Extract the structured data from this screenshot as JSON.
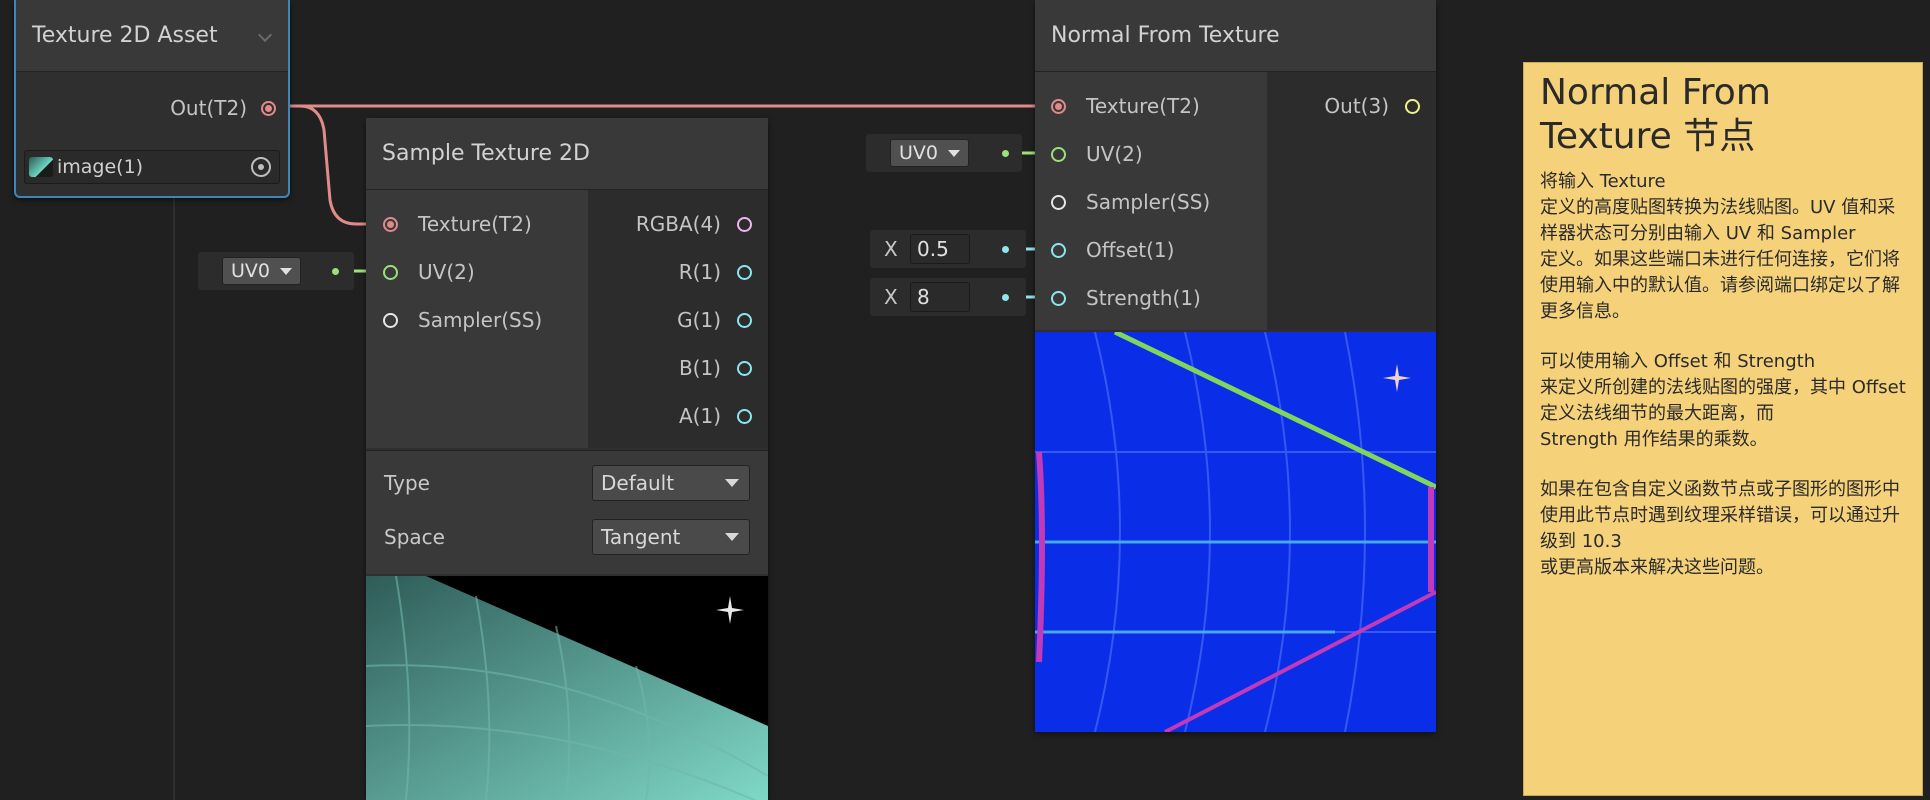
{
  "colors": {
    "canvas_bg": "#202020",
    "node_bg": "#393939",
    "texture_port": "#e08a8a",
    "uv_port": "#9ce07a",
    "sampler_port": "#e6e6e6",
    "vector4_port": "#f0b6f0",
    "vector1_port": "#8ce6f0",
    "vector3_port": "#f0f08c",
    "selection_outline": "#3f86b8",
    "sticky_bg": "#f5d27a"
  },
  "asset_node": {
    "title": "Texture 2D Asset",
    "output_label": "Out(T2)",
    "object_field_value": "image(1)",
    "collapse_icon": "chevron-down-icon",
    "picker_icon": "object-picker-icon"
  },
  "sample_node": {
    "title": "Sample Texture 2D",
    "inputs": [
      "Texture(T2)",
      "UV(2)",
      "Sampler(SS)"
    ],
    "outputs": [
      "RGBA(4)",
      "R(1)",
      "G(1)",
      "B(1)",
      "A(1)"
    ],
    "type_label": "Type",
    "type_value": "Default",
    "space_label": "Space",
    "space_value": "Tangent",
    "uv_field_value": "UV0"
  },
  "normal_node": {
    "title": "Normal From Texture",
    "inputs": [
      "Texture(T2)",
      "UV(2)",
      "Sampler(SS)",
      "Offset(1)",
      "Strength(1)"
    ],
    "output_label": "Out(3)",
    "uv_field_value": "UV0",
    "offset_axis": "X",
    "offset_value": "0.5",
    "strength_axis": "X",
    "strength_value": "8"
  },
  "sticky_note": {
    "title": "Normal From Texture 节点",
    "paragraphs": [
      "将输入 Texture\n定义的高度贴图转换为法线贴图。UV 值和采样器状态可分别由输入 UV 和 Sampler\n定义。如果这些端口未进行任何连接，它们将使用输入中的默认值。请参阅端口绑定以了解更多信息。",
      "可以使用输入 Offset 和 Strength\n来定义所创建的法线贴图的强度，其中 Offset\n定义法线细节的最大距离，而\nStrength 用作结果的乘数。",
      "如果在包含自定义函数节点或子图形的图形中使用此节点时遇到纹理采样错误，可以通过升级到 10.3\n或更高版本来解决这些问题。"
    ]
  }
}
